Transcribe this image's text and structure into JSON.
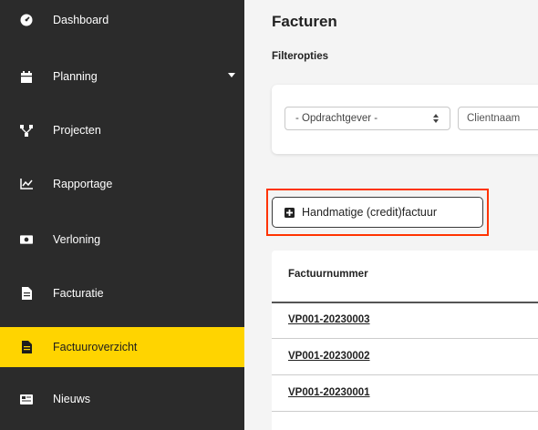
{
  "sidebar": {
    "items": [
      {
        "label": "Dashboard",
        "icon": "dashboard-gauge-icon"
      },
      {
        "label": "Planning",
        "icon": "calendar-icon"
      },
      {
        "label": "Projecten",
        "icon": "sitemap-icon"
      },
      {
        "label": "Rapportage",
        "icon": "line-chart-icon"
      },
      {
        "label": "Verloning",
        "icon": "money-bill-icon"
      },
      {
        "label": "Facturatie",
        "icon": "invoice-icon"
      },
      {
        "label": "Factuuroverzicht",
        "icon": "invoice-icon"
      },
      {
        "label": "Nieuws",
        "icon": "newspaper-icon"
      }
    ],
    "active_color": "#ffd400"
  },
  "main": {
    "title": "Facturen",
    "filter_heading": "Filteropties",
    "filters": {
      "client_select_value": "- Opdrachtgever -",
      "client_name_placeholder": "Clientnaam"
    },
    "manual_invoice_button": "Handmatige (credit)factuur",
    "table": {
      "column_header": "Factuurnummer",
      "rows": [
        "VP001-20230003",
        "VP001-20230002",
        "VP001-20230001"
      ]
    }
  }
}
